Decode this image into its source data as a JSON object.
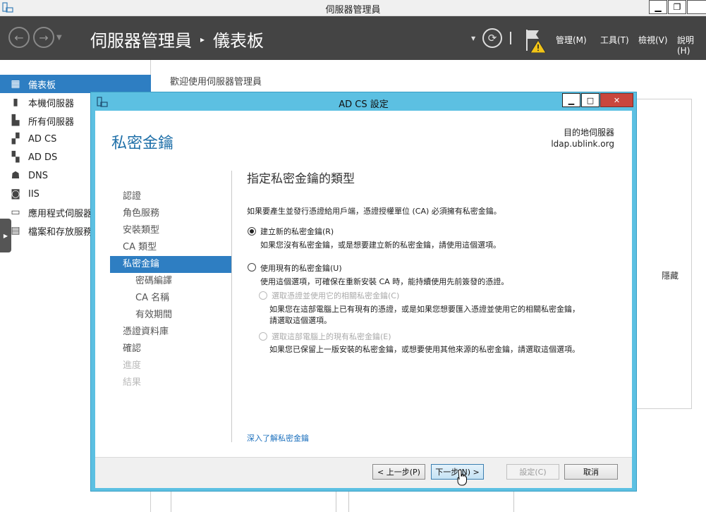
{
  "window": {
    "title": "伺服器管理員"
  },
  "toolbar": {
    "breadcrumb_app": "伺服器管理員",
    "breadcrumb_sep": "▸",
    "breadcrumb_page": "儀表板",
    "menus": [
      "管理(M)",
      "工具(T)",
      "檢視(V)",
      "說明(H)"
    ]
  },
  "sidebar": {
    "items": [
      {
        "label": "儀表板",
        "icon": "dashboard-icon",
        "active": true
      },
      {
        "label": "本機伺服器",
        "icon": "server-icon"
      },
      {
        "label": "所有伺服器",
        "icon": "servers-icon"
      },
      {
        "label": "AD CS",
        "icon": "adcs-icon"
      },
      {
        "label": "AD DS",
        "icon": "adds-icon"
      },
      {
        "label": "DNS",
        "icon": "dns-icon"
      },
      {
        "label": "IIS",
        "icon": "iis-icon"
      },
      {
        "label": "應用程式伺服器",
        "icon": "app-server-icon"
      },
      {
        "label": "檔案和存放服務",
        "icon": "file-storage-icon"
      }
    ]
  },
  "dashboard": {
    "welcome": "歡迎使用伺服器管理員",
    "hide": "隱藏"
  },
  "dialog": {
    "title": "AD CS 設定",
    "page_title": "私密金鑰",
    "dest_label": "目的地伺服器",
    "dest_server": "ldap.ublink.org",
    "nav": [
      {
        "label": "認證",
        "state": "normal"
      },
      {
        "label": "角色服務",
        "state": "normal"
      },
      {
        "label": "安裝類型",
        "state": "normal"
      },
      {
        "label": "CA 類型",
        "state": "normal"
      },
      {
        "label": "私密金鑰",
        "state": "active"
      },
      {
        "label": "密碼編譯",
        "state": "sub"
      },
      {
        "label": "CA 名稱",
        "state": "sub"
      },
      {
        "label": "有效期間",
        "state": "sub"
      },
      {
        "label": "憑證資料庫",
        "state": "normal"
      },
      {
        "label": "確認",
        "state": "normal"
      },
      {
        "label": "進度",
        "state": "disabled"
      },
      {
        "label": "結果",
        "state": "disabled"
      }
    ],
    "section_title": "指定私密金鑰的類型",
    "intro": "如果要產生並發行憑證給用戶端，憑證授權單位 (CA) 必須擁有私密金鑰。",
    "option_new": {
      "label": "建立新的私密金鑰(R)",
      "desc": "如果您沒有私密金鑰，或是想要建立新的私密金鑰，請使用這個選項。",
      "checked": true
    },
    "option_existing": {
      "label": "使用現有的私密金鑰(U)",
      "desc": "使用這個選項，可確保在重新安裝 CA 時，能持續使用先前簽發的憑證。",
      "checked": false
    },
    "sub_option_cert": {
      "label": "選取憑證並使用它的相關私密金鑰(C)",
      "desc1": "如果您在這部電腦上已有現有的憑證，或是如果您想要匯入憑證並使用它的相關私密金鑰，",
      "desc2": "請選取這個選項。"
    },
    "sub_option_key": {
      "label": "選取這部電腦上的現有私密金鑰(E)",
      "desc": "如果您已保留上一版安裝的私密金鑰，或想要使用其他來源的私密金鑰，請選取這個選項。"
    },
    "learn_more": "深入了解私密金鑰",
    "buttons": {
      "prev": "< 上一步(P)",
      "next": "下一步(N) >",
      "configure": "設定(C)",
      "cancel": "取消"
    }
  }
}
